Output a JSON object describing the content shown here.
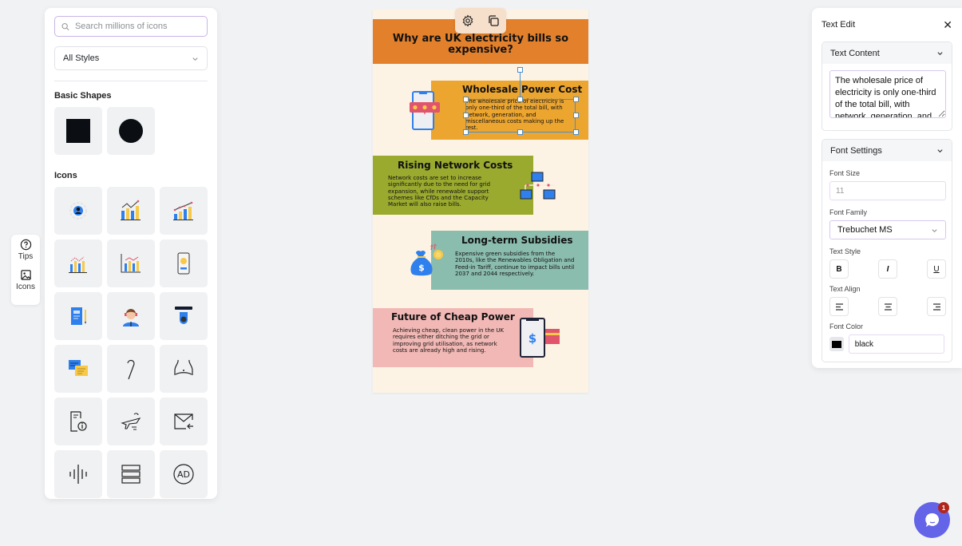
{
  "rail": {
    "items": [
      {
        "label": "Tips",
        "icon": "help-circle-icon"
      },
      {
        "label": "Icons",
        "icon": "image-icon"
      }
    ]
  },
  "icon_panel": {
    "search_placeholder": "Search millions of icons",
    "search_value": "",
    "style_select": "All Styles",
    "basic_shapes_title": "Basic Shapes",
    "basic_shapes": [
      "square",
      "circle"
    ],
    "icons_title": "Icons",
    "icons": [
      "user-gear-icon",
      "bar-chart-trend-icon",
      "bar-chart-growth-icon",
      "bar-chart-line-icon",
      "bar-chart-axis-icon",
      "mobile-payment-icon",
      "notebook-pencil-icon",
      "support-agent-icon",
      "security-camera-icon",
      "chat-bubbles-icon",
      "cane-icon",
      "belly-icon",
      "document-info-icon",
      "airplane-icon",
      "mail-incoming-icon",
      "sound-wave-icon",
      "stacked-bars-icon",
      "ad-badge-icon"
    ]
  },
  "canvas": {
    "title": "Why are UK electricity bills so expensive?",
    "colors": {
      "background": "#fdf3e4",
      "header": "#e2802b",
      "block1": "#eca52f",
      "block2": "#9aaa2f",
      "block3": "#8bbdaf",
      "block4": "#f1b8b5"
    },
    "blocks": [
      {
        "heading": "Wholesale Power Cost",
        "body": "The wholesale price of electricity is only one-third of the total bill, with network, generation, and miscellaneous costs making up the rest."
      },
      {
        "heading": "Rising Network Costs",
        "body": "Network costs are set to increase significantly due to the need for grid expansion, while renewable support schemes like CfDs and the Capacity Market will also raise bills."
      },
      {
        "heading": "Long-term Subsidies",
        "body": "Expensive green subsidies from the 2010s, like the Renewables Obligation and Feed-in Tariff, continue to impact bills until 2037 and 2044 respectively."
      },
      {
        "heading": "Future of Cheap Power",
        "body": "Achieving cheap, clean power in the UK requires either ditching the grid or improving grid utilisation, as network costs are already high and rising."
      }
    ]
  },
  "text_edit": {
    "title": "Text Edit",
    "text_content_label": "Text Content",
    "text_content_value": "The wholesale price of electricity is only one-third of the total bill, with network, generation, and miscellaneous costs making up the rest.",
    "font_settings_label": "Font Settings",
    "font_size_label": "Font Size",
    "font_size_value": "11",
    "font_family_label": "Font Family",
    "font_family_value": "Trebuchet MS",
    "text_style_label": "Text Style",
    "bold": "B",
    "italic": "I",
    "underline": "U",
    "text_align_label": "Text Align",
    "font_color_label": "Font Color",
    "font_color_value": "black"
  },
  "chat": {
    "badge_count": "1",
    "accent": "#6464e9"
  }
}
